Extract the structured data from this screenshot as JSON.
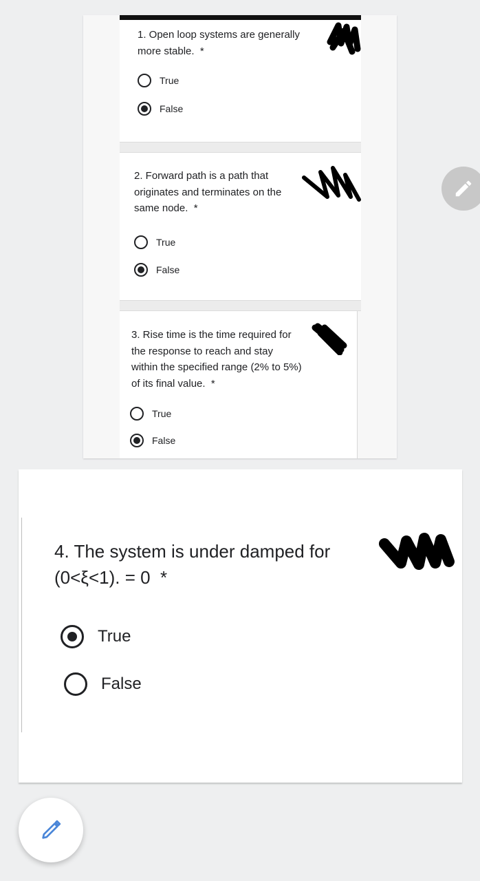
{
  "form": {
    "questions": [
      {
        "line1": "1. Open loop systems are generally",
        "line2": "more stable.",
        "required": "*",
        "options": [
          {
            "label": "True",
            "selected": false
          },
          {
            "label": "False",
            "selected": true
          }
        ]
      },
      {
        "line1": "2. Forward path is a path that",
        "line2": "originates and terminates on the",
        "line3": "same node.",
        "required": "*",
        "options": [
          {
            "label": "True",
            "selected": false
          },
          {
            "label": "False",
            "selected": true
          }
        ]
      },
      {
        "line1": "3. Rise time is the time required for",
        "line2": "the response to reach and stay",
        "line3": "within the specified range (2% to 5%)",
        "line4": "of its final value.",
        "required": "*",
        "options": [
          {
            "label": "True",
            "selected": false
          },
          {
            "label": "False",
            "selected": true
          }
        ]
      },
      {
        "line1": "4. The system is under damped for",
        "line2": "(0<ξ<1). = 0",
        "required": "*",
        "options": [
          {
            "label": "True",
            "selected": true
          },
          {
            "label": "False",
            "selected": false
          }
        ]
      }
    ]
  },
  "icons": {
    "edit_fab_small": "pencil-icon",
    "edit_fab_large": "pencil-icon"
  },
  "colors": {
    "background": "#eeeff0",
    "fab_small_bg": "#c8c8c8",
    "fab_large_icon": "#4a86d8",
    "radio": "#202124"
  }
}
